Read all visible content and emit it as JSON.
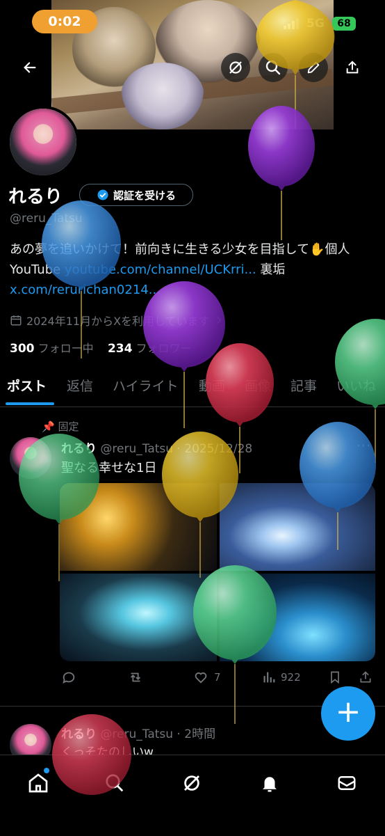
{
  "status_bar": {
    "time": "0:02",
    "network": "5G",
    "battery": "68"
  },
  "profile": {
    "name": "れるり",
    "verify_label": "認証を受ける",
    "handle": "@reru_Tatsu",
    "bio_text": "あの夢を追いかけて！前向きに生きる少女を目指して✋個人 YouTube ",
    "bio_link1": "youtube.com/channel/UCKrri...",
    "bio_mid": " 裏垢 ",
    "bio_link2": "x.com/rerurichan0214...",
    "joined": "2024年11月からXを利用しています",
    "following_count": "300",
    "following_label": "フォロー中",
    "followers_count": "234",
    "followers_label": "フォロワー"
  },
  "tabs": [
    "ポスト",
    "返信",
    "ハイライト",
    "動画",
    "画像",
    "記事",
    "いいね"
  ],
  "pinned_post": {
    "pinned_label": "固定",
    "name": "れるり",
    "handle": "@reru_Tatsu",
    "date": "2025/12/28",
    "text": "聖なる幸せな1日",
    "likes": "7",
    "views": "922"
  },
  "second_post": {
    "name": "れるり",
    "handle": "@reru_Tatsu",
    "time": "2時間",
    "text": "くっそたのしいw"
  },
  "colors": {
    "accent": "#1d9bf0",
    "time_pill": "#f0a030",
    "battery": "#35c759"
  },
  "icons": [
    "back-icon",
    "grok-icon",
    "search-icon",
    "edit-icon",
    "share-icon",
    "verified-icon",
    "calendar-icon",
    "chevron-right-icon",
    "reply-icon",
    "retweet-icon",
    "like-icon",
    "views-icon",
    "bookmark-icon",
    "home-icon",
    "bell-icon",
    "mail-icon",
    "compose-icon"
  ]
}
